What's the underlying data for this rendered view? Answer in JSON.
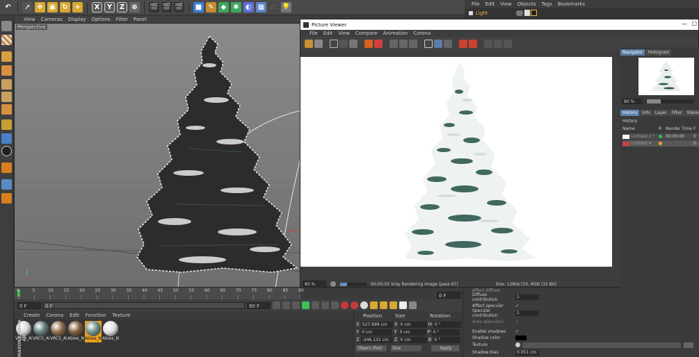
{
  "toolbar": {
    "axis_x": "X",
    "axis_y": "Y",
    "axis_z": "Z"
  },
  "viewport": {
    "menu": [
      "View",
      "Cameras",
      "Display",
      "Options",
      "Filter",
      "Panel"
    ],
    "label": "Perspective"
  },
  "object_manager": {
    "menu": [
      "File",
      "Edit",
      "View",
      "Objects",
      "Tags",
      "Bookmarks"
    ],
    "object_name": "Light"
  },
  "timeline": {
    "ticks": [
      "0",
      "5",
      "10",
      "15",
      "20",
      "25",
      "30",
      "35",
      "40",
      "45",
      "50",
      "55",
      "60",
      "65",
      "70",
      "75",
      "80",
      "85",
      "90"
    ],
    "start_frame": "0 F",
    "current_frame": "0 F",
    "range_end": "90 F",
    "end_frame": "90 F",
    "right_frame": "0 F"
  },
  "materials": {
    "menu": [
      "Create",
      "Corona",
      "Edit",
      "Function",
      "Texture"
    ],
    "items": [
      {
        "label": "VRCS_Al",
        "color": "#d8d8d8"
      },
      {
        "label": "VRCS_Al",
        "color": "#5e7a78"
      },
      {
        "label": "VRCS_Al",
        "color": "#8a6a48"
      },
      {
        "label": "Abies_N",
        "color": "#7a5c3a"
      },
      {
        "label": "Abies_N",
        "color": "#6f8f86"
      },
      {
        "label": "Abies_N",
        "color": "#e0e0e0"
      }
    ],
    "brand": "MAXON CINEMA 4D"
  },
  "coords": {
    "headers": [
      "Position",
      "Size",
      "Rotation"
    ],
    "rows": [
      {
        "axis": "X",
        "pos": "527.699 cm",
        "size_axis": "X",
        "size": "0 cm",
        "rot_axis": "H",
        "rot": "0 °"
      },
      {
        "axis": "Y",
        "pos": "0 cm",
        "size_axis": "Y",
        "size": "0 cm",
        "rot_axis": "P",
        "rot": "0 °"
      },
      {
        "axis": "Z",
        "pos": "-246.131 cm",
        "size_axis": "Z",
        "size": "0 cm",
        "rot_axis": "B",
        "rot": "0 °"
      }
    ],
    "mode": "Object (Rel)",
    "size_mode": "Size",
    "apply": "Apply"
  },
  "attributes": {
    "rows": [
      {
        "label": "Affect diffuse",
        "value": ""
      },
      {
        "label": "Diffuse contribution",
        "value": "1"
      },
      {
        "label": "Affect specular",
        "value": "✓"
      },
      {
        "label": "Specular contribution",
        "value": "1"
      },
      {
        "label": "Area speculars",
        "value": "✓"
      },
      {
        "label": "Enable shadows",
        "value": "✓"
      },
      {
        "label": "Shadow color",
        "value": ""
      },
      {
        "label": "Texture",
        "value": ""
      },
      {
        "label": "Shadow bias",
        "value": "0.051 cm"
      }
    ]
  },
  "picture_viewer": {
    "title": "Picture Viewer",
    "menu": [
      "File",
      "Edit",
      "View",
      "Compare",
      "Animation",
      "Corona"
    ],
    "zoom": "80 %",
    "status": "00:00:55 Vray Rendering image (pass 67)",
    "size_info": "Size: 1280x720, RGB (32 Bit)",
    "progress": 0.25,
    "nav_tabs": [
      "Navigator",
      "Histogram"
    ],
    "nav_zoom": "80 %",
    "tabs": [
      "History",
      "Info",
      "Layer",
      "Filter",
      "Stereo"
    ],
    "history_label": "History",
    "history_headers": [
      "Name",
      "R",
      "Render Time",
      "F"
    ],
    "history_rows": [
      {
        "name": "Untitled 2 *",
        "time": "00:00:00",
        "f": "0",
        "dot": "#2ec24a"
      },
      {
        "name": "Untitled 4",
        "time": "",
        "f": "0",
        "dot": "#f0a020"
      }
    ]
  }
}
